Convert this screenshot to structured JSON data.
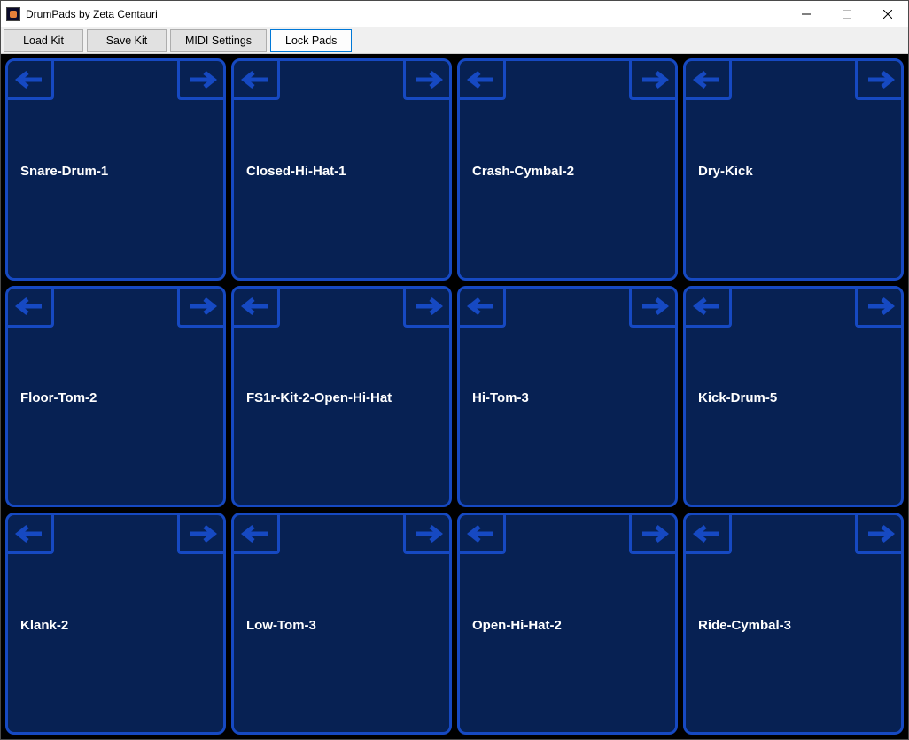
{
  "window": {
    "title": "DrumPads by Zeta Centauri"
  },
  "toolbar": {
    "load_kit": "Load Kit",
    "save_kit": "Save Kit",
    "midi_settings": "MIDI Settings",
    "lock_pads": "Lock Pads"
  },
  "pads": [
    {
      "label": "Snare-Drum-1"
    },
    {
      "label": "Closed-Hi-Hat-1"
    },
    {
      "label": "Crash-Cymbal-2"
    },
    {
      "label": "Dry-Kick"
    },
    {
      "label": "Floor-Tom-2"
    },
    {
      "label": "FS1r-Kit-2-Open-Hi-Hat"
    },
    {
      "label": "Hi-Tom-3"
    },
    {
      "label": "Kick-Drum-5"
    },
    {
      "label": "Klank-2"
    },
    {
      "label": "Low-Tom-3"
    },
    {
      "label": "Open-Hi-Hat-2"
    },
    {
      "label": "Ride-Cymbal-3"
    }
  ]
}
